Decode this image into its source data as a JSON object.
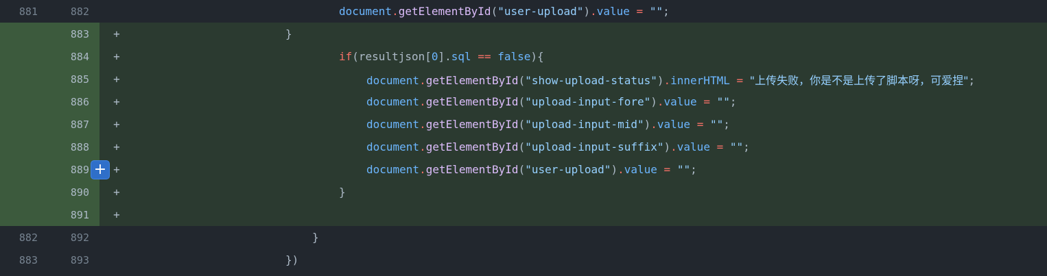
{
  "rows": [
    {
      "type": "ctx",
      "old": "881",
      "new": "882",
      "marker": ""
    },
    {
      "type": "add",
      "old": "",
      "new": "883",
      "marker": "+"
    },
    {
      "type": "add",
      "old": "",
      "new": "884",
      "marker": "+"
    },
    {
      "type": "add",
      "old": "",
      "new": "885",
      "marker": "+"
    },
    {
      "type": "add",
      "old": "",
      "new": "886",
      "marker": "+"
    },
    {
      "type": "add",
      "old": "",
      "new": "887",
      "marker": "+"
    },
    {
      "type": "add",
      "old": "",
      "new": "888",
      "marker": "+"
    },
    {
      "type": "add",
      "old": "",
      "new": "889",
      "marker": "+"
    },
    {
      "type": "add",
      "old": "",
      "new": "890",
      "marker": "+"
    },
    {
      "type": "add",
      "old": "",
      "new": "891",
      "marker": "+"
    },
    {
      "type": "ctx",
      "old": "882",
      "new": "892",
      "marker": ""
    },
    {
      "type": "ctx",
      "old": "883",
      "new": "893",
      "marker": ""
    }
  ],
  "code": {
    "document": "document",
    "getById": "getElementById",
    "value": "value",
    "eq": "=",
    "empty": "\"\"",
    "semi": ";",
    "dot": ".",
    "lp": "(",
    "rp": ")",
    "l0_arg": "\"user-upload\"",
    "l1": "}",
    "l2_if": "if",
    "l2_a": "(resultjson[",
    "l2_zero": "0",
    "l2_b": "].",
    "l2_sql": "sql",
    "l2_eqeq": "==",
    "l2_false": "false",
    "l2_c": "){",
    "l3_arg": "\"show-upload-status\"",
    "l3_prop": "innerHTML",
    "l3_str": "\"上传失败，你是不是上传了脚本呀，可爱捏\"",
    "l4_arg": "\"upload-input-fore\"",
    "l5_arg": "\"upload-input-mid\"",
    "l6_arg": "\"upload-input-suffix\"",
    "l7_arg": "\"user-upload\"",
    "l8": "}",
    "l10": "}",
    "l11": "})"
  },
  "expand_button": {
    "icon": "plus-icon",
    "label": "+"
  },
  "colors": {
    "bg": "#22272e",
    "added_bg": "#2b3a30",
    "added_gutter": "#3c5a3d",
    "accent": "#2f6fc9"
  }
}
